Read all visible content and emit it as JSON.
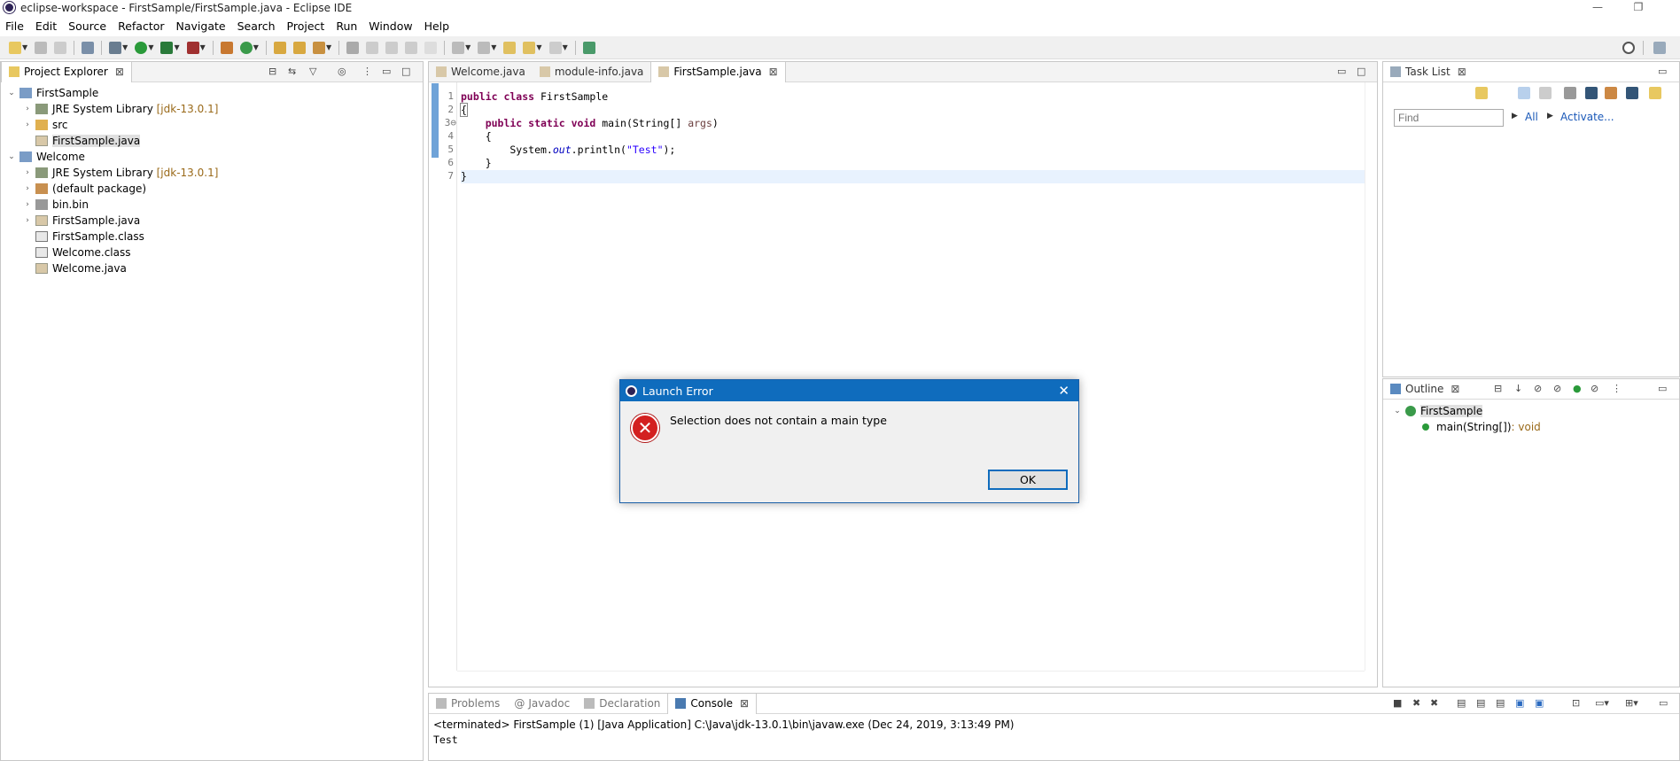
{
  "window": {
    "title": "eclipse-workspace - FirstSample/FirstSample.java - Eclipse IDE",
    "min": "—",
    "max": "❐",
    "close": "✕"
  },
  "menu": [
    "File",
    "Edit",
    "Source",
    "Refactor",
    "Navigate",
    "Search",
    "Project",
    "Run",
    "Window",
    "Help"
  ],
  "project_explorer": {
    "tab": "Project Explorer",
    "tree": [
      {
        "label": "FirstSample",
        "tw": "⌄",
        "icon": "project"
      },
      {
        "label": "JRE System Library",
        "decoration": "[jdk-13.0.1]",
        "tw": "›",
        "icon": "library"
      },
      {
        "label": "src",
        "tw": "›",
        "icon": "folder"
      },
      {
        "label": "FirstSample.java",
        "tw": "",
        "icon": "java-file",
        "selected": true
      },
      {
        "label": "Welcome",
        "tw": "⌄",
        "icon": "project"
      },
      {
        "label": "JRE System Library",
        "decoration": "[jdk-13.0.1]",
        "tw": "›",
        "icon": "library"
      },
      {
        "label": "(default package)",
        "tw": "›",
        "icon": "package"
      },
      {
        "label": "bin.bin",
        "tw": "›",
        "icon": "binfile"
      },
      {
        "label": "FirstSample.java",
        "tw": "›",
        "icon": "java-file"
      },
      {
        "label": "FirstSample.class",
        "tw": "",
        "icon": "class-file"
      },
      {
        "label": "Welcome.class",
        "tw": "",
        "icon": "class-file"
      },
      {
        "label": "Welcome.java",
        "tw": "",
        "icon": "java-file"
      }
    ]
  },
  "editor": {
    "tabs": [
      "Welcome.java",
      "module-info.java",
      "FirstSample.java"
    ],
    "active_tab": 2,
    "lines": [
      "1",
      "2",
      "3⊖",
      "4",
      "5",
      "6",
      "7"
    ],
    "code": {
      "l1_kw": "public class ",
      "l1_name": "FirstSample",
      "l2": "{",
      "l3_kw": "    public static void ",
      "l3_a": "main(String[] ",
      "l3_param": "args",
      "l3_b": ")",
      "l4": "    {",
      "l5_a": "        System.",
      "l5_field": "out",
      "l5_b": ".println(",
      "l5_str": "\"Test\"",
      "l5_c": ");",
      "l6": "    }",
      "l7": "}"
    }
  },
  "task_list": {
    "tab": "Task List",
    "find_placeholder": "Find",
    "all": "All",
    "activate": "Activate..."
  },
  "outline": {
    "tab": "Outline",
    "class_name": "FirstSample",
    "method": "main(String[])",
    "method_type": " : void"
  },
  "bottom": {
    "tabs": [
      "Problems",
      "Javadoc",
      "Declaration",
      "Console"
    ],
    "active_tab": 3,
    "status": "<terminated> FirstSample (1) [Java Application] C:\\Java\\jdk-13.0.1\\bin\\javaw.exe (Dec 24, 2019, 3:13:49 PM)",
    "output": "Test"
  },
  "dialog": {
    "title": "Launch Error",
    "message": "Selection does not contain a main type",
    "ok": "OK",
    "close": "✕",
    "error_glyph": "✕"
  },
  "colors": {
    "accent": "#0f6cbd",
    "keyword": "#7f0055",
    "string": "#2a00ff",
    "error": "#d32020"
  }
}
